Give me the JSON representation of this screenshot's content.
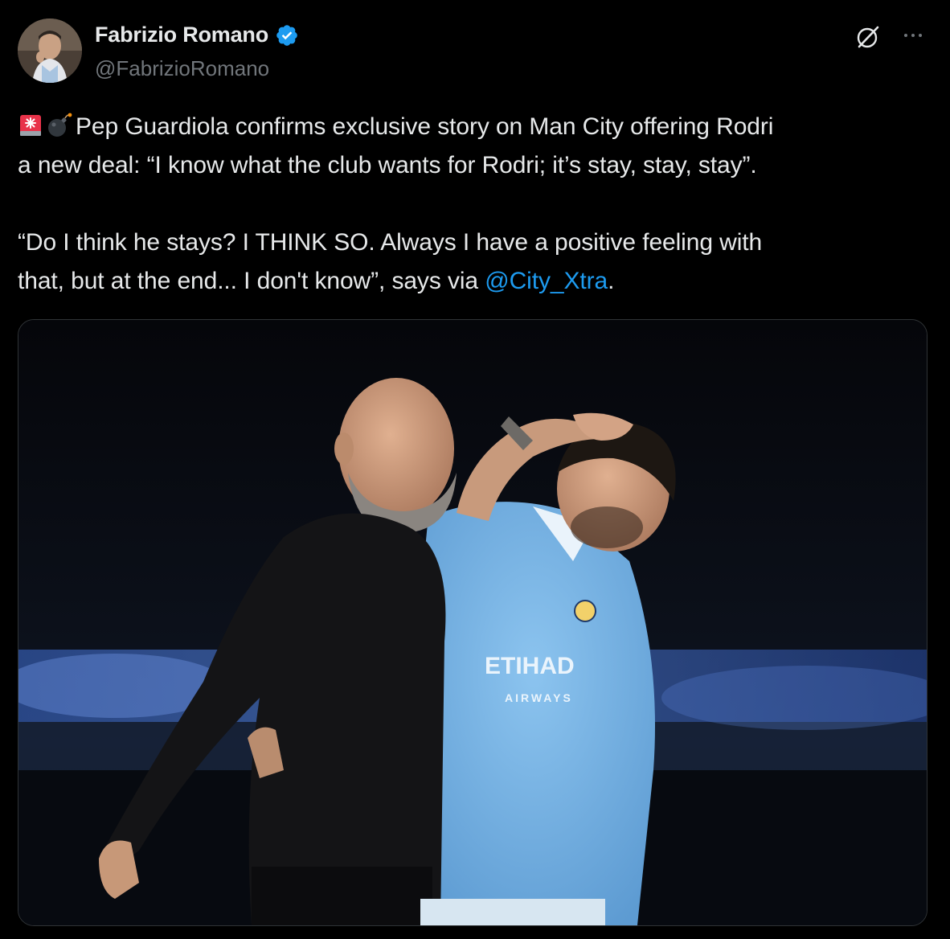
{
  "author": {
    "display_name": "Fabrizio Romano",
    "handle": "@FabrizioRomano",
    "verified": true,
    "avatar_icon": "profile-photo"
  },
  "header_actions": {
    "grok_icon": "grok-icon",
    "more_icon": "more-horizontal-icon"
  },
  "tweet": {
    "emojis": [
      "rotating-light-emoji",
      "bomb-emoji"
    ],
    "line1": "Pep Guardiola confirms exclusive story on Man City offering Rodri",
    "line2": "a new deal: “I know what the club wants for Rodri; it’s stay, stay, stay”.",
    "line3": "“Do I think he stays? I THINK SO. Always I have a positive feeling with",
    "line4_pre": "that, but at the end... I don't know”, says via ",
    "mention": "@City_Xtra",
    "line4_post": "."
  },
  "media": {
    "description_icon": "photo",
    "shirt_sponsor": "ETIHAD",
    "shirt_sponsor_sub": "AIRWAYS"
  },
  "colors": {
    "background": "#000000",
    "text": "#e7e9ea",
    "secondary": "#71767b",
    "link": "#1d9bf0",
    "verified": "#1d9bf0",
    "city_blue": "#7ab6e6"
  }
}
